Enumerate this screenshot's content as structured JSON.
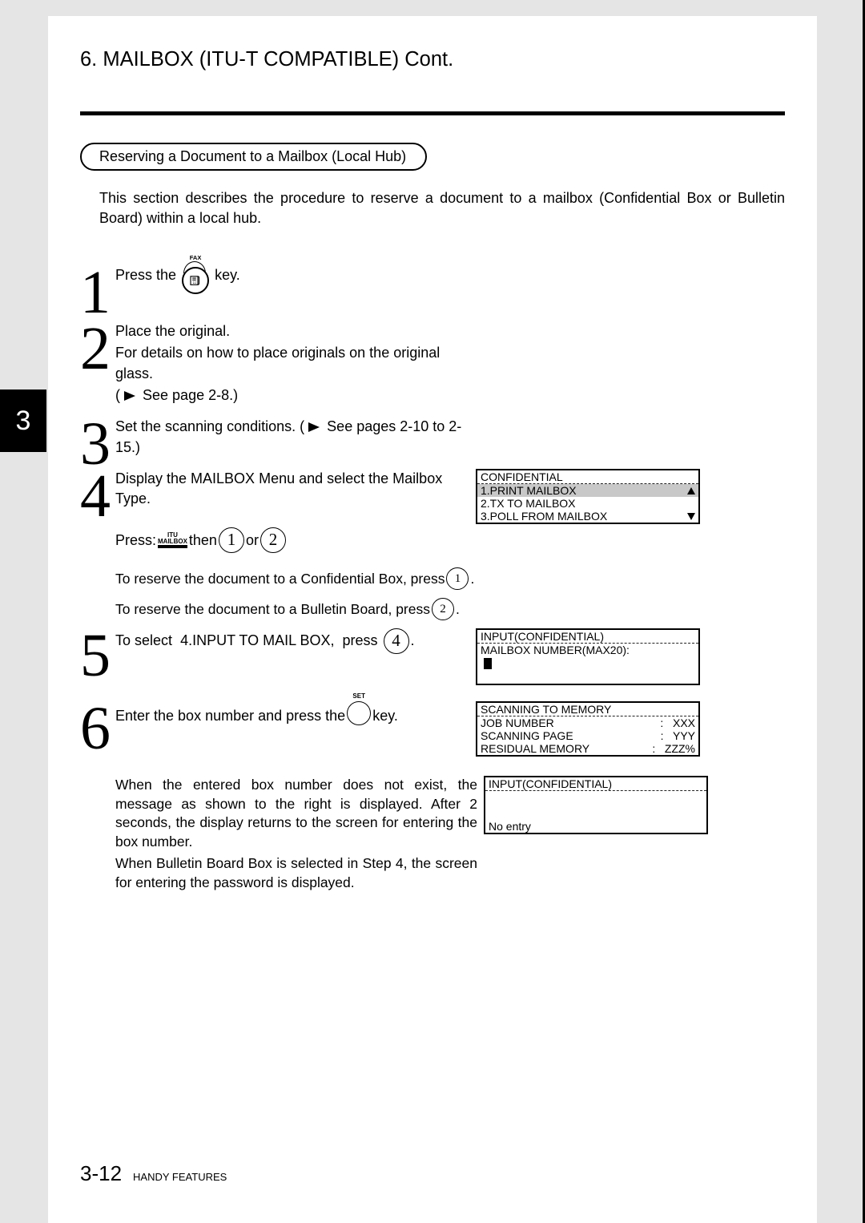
{
  "header": {
    "title": "6. MAILBOX (ITU-T COMPATIBLE) Cont."
  },
  "sidetab": {
    "number": "3"
  },
  "section": {
    "pill": "Reserving a Document to a Mailbox (Local Hub)",
    "intro": "This section describes the procedure to reserve a document to a mailbox (Confidential Box or Bulletin Board) within a local hub."
  },
  "steps": {
    "s1": {
      "num": "1",
      "pre": "Press the ",
      "post": " key.",
      "fax_label": "FAX"
    },
    "s2": {
      "num": "2",
      "line1": "Place the original.",
      "line2": "For details on how to place originals on the original glass.",
      "line3_pre": "( ",
      "line3_post": " See page 2-8.)"
    },
    "s3": {
      "num": "3",
      "line1_pre": "Set the scanning conditions. ( ",
      "line1_post": " See pages 2-10 to 2-15.)"
    },
    "s4": {
      "num": "4",
      "line1": "Display the MAILBOX Menu and select the Mailbox Type.",
      "press_pre": "Press: ",
      "mb_top": "ITU",
      "mb_mid": "MAILBOX",
      "press_then": " then ",
      "press_or": " or ",
      "k1": "1",
      "k2": "2",
      "sub1_pre": "To reserve the document to a Confidential Box, press ",
      "sub1_key": "1",
      "sub2_pre": "To reserve the document to a Bulletin Board, press ",
      "sub2_key": "2"
    },
    "s5": {
      "num": "5",
      "pre": "To select ",
      "mid": "4.INPUT TO MAIL BOX,",
      "post1": " press ",
      "key": "4",
      "post2": "."
    },
    "s6": {
      "num": "6",
      "pre": "Enter the box number and press the ",
      "set_label": "SET",
      "post": " key."
    },
    "note1": "When the entered box number does not exist, the message as shown to the right is displayed. After 2 seconds, the display returns to the screen for entering the box number.",
    "note2": "When Bulletin Board Box is selected in Step 4, the screen for entering the password is displayed."
  },
  "displays": {
    "d4": {
      "title": "CONFIDENTIAL",
      "l1": "1.PRINT MAILBOX",
      "l2": "2.TX TO MAILBOX",
      "l3": "3.POLL FROM MAILBOX"
    },
    "d5": {
      "title": "INPUT(CONFIDENTIAL)",
      "l1": "MAILBOX NUMBER(MAX20):"
    },
    "d6": {
      "title": "SCANNING TO MEMORY",
      "r1l": "JOB NUMBER",
      "r1v": ":   XXX",
      "r2l": "SCANNING PAGE",
      "r2v": ":   YYY",
      "r3l": "RESIDUAL MEMORY",
      "r3v": ":   ZZZ%"
    },
    "dErr": {
      "title": "INPUT(CONFIDENTIAL)",
      "l1": "",
      "l2": "No entry"
    }
  },
  "footer": {
    "page": "3-12",
    "section": "HANDY FEATURES"
  }
}
